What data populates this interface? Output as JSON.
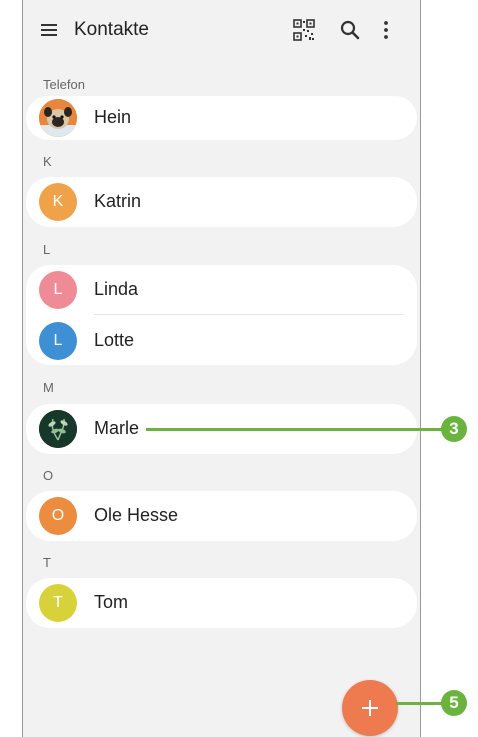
{
  "app": {
    "title": "Kontakte"
  },
  "toolbar": {
    "menu_icon": "menu-icon",
    "qr_icon": "qr-code-icon",
    "search_icon": "search-icon",
    "more_icon": "more-vertical-icon"
  },
  "sections": [
    {
      "header": "Telefon",
      "contacts": [
        {
          "name": "Hein",
          "initial": "",
          "avatar": "dog-photo"
        }
      ]
    },
    {
      "header": "K",
      "contacts": [
        {
          "name": "Katrin",
          "initial": "K",
          "color": "#f0a24a"
        }
      ]
    },
    {
      "header": "L",
      "contacts": [
        {
          "name": "Linda",
          "initial": "L",
          "color": "#ef8a97"
        },
        {
          "name": "Lotte",
          "initial": "L",
          "color": "#3f8fd4"
        }
      ]
    },
    {
      "header": "M",
      "contacts": [
        {
          "name": "Marle",
          "initial": "",
          "avatar": "plant-photo"
        }
      ]
    },
    {
      "header": "O",
      "contacts": [
        {
          "name": "Ole Hesse",
          "initial": "O",
          "color": "#ec8c3f"
        }
      ]
    },
    {
      "header": "T",
      "contacts": [
        {
          "name": "Tom",
          "initial": "T",
          "color": "#d8d23a"
        }
      ]
    }
  ],
  "fab": {
    "icon": "plus-icon",
    "color": "#ed7b4f"
  },
  "callouts": [
    {
      "label": "3",
      "target": "Marle"
    },
    {
      "label": "5",
      "target": "add-contact"
    }
  ],
  "colors": {
    "accent": "#6ab43e",
    "background": "#f2f2f2"
  }
}
